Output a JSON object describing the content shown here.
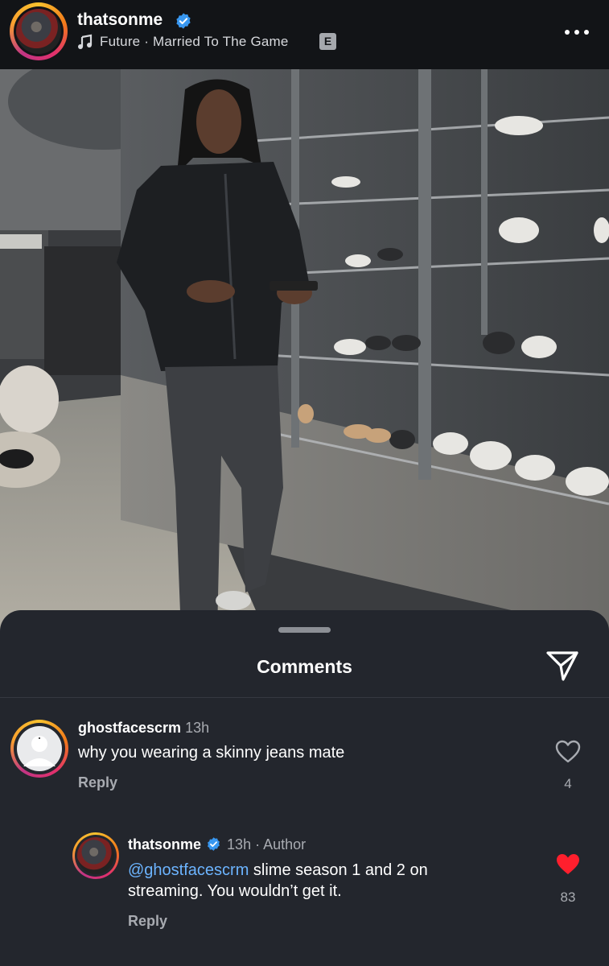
{
  "header": {
    "username": "thatsonme",
    "music_text": "Future · Married To The Game",
    "explicit_badge": "E"
  },
  "comments_sheet": {
    "title": "Comments",
    "comments": [
      {
        "username": "ghostfacescrm",
        "time": "13h",
        "text": "why you wearing a skinny jeans mate",
        "reply_label": "Reply",
        "likes": "4",
        "liked": false
      },
      {
        "username": "thatsonme",
        "time": "13h",
        "author_tag": "· Author",
        "mention": "@ghostfacescrm",
        "text": " slime season 1 and 2 on streaming. You wouldn’t get it.",
        "reply_label": "Reply",
        "likes": "83",
        "liked": true
      }
    ]
  },
  "colors": {
    "background": "#15171b",
    "sheet": "#23262d",
    "verified": "#3897f0",
    "mention": "#6cb4ff",
    "like_active": "#ff1f2d"
  },
  "icons": [
    "music-note-icon",
    "verified-badge-icon",
    "more-options-icon",
    "send-icon",
    "heart-icon",
    "heart-filled-icon"
  ]
}
